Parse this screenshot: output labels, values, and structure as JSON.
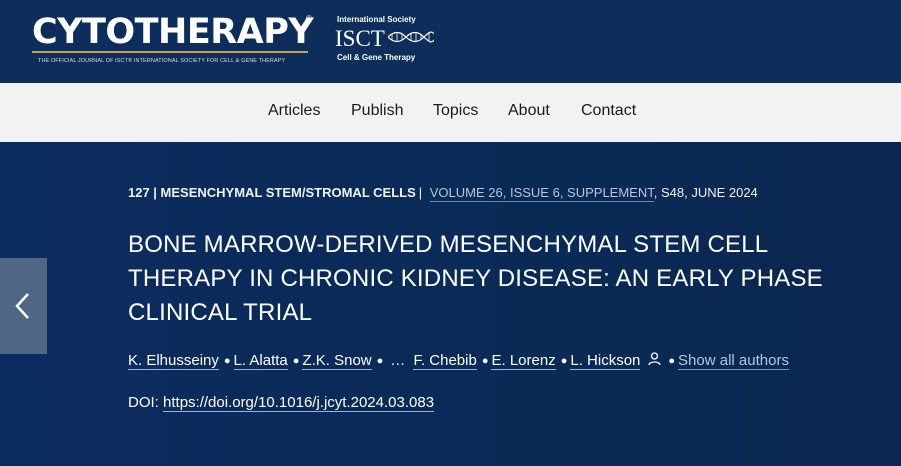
{
  "header": {
    "logo": "CYTOTHERAPY",
    "logo_reg": "®",
    "tagline": "THE OFFICIAL JOURNAL OF ISCT® INTERNATIONAL SOCIETY FOR CELL & GENE THERAPY",
    "isct_top": "International Society",
    "isct_name": "ISCT",
    "isct_sub": "Cell & Gene Therapy"
  },
  "nav": {
    "items": [
      {
        "label": "Articles"
      },
      {
        "label": "Publish"
      },
      {
        "label": "Topics"
      },
      {
        "label": "About"
      },
      {
        "label": "Contact"
      }
    ]
  },
  "article": {
    "section": "127 | MESENCHYMAL STEM/STROMAL CELLS",
    "separator": "|",
    "volume_link": "VOLUME 26, ISSUE 6, SUPPLEMENT",
    "pages_date": ", S48, JUNE 2024",
    "title_lines": [
      "BONE MARROW-DERIVED MESENCHYMAL STEM CELL",
      "THERAPY IN CHRONIC KIDNEY DISEASE: AN EARLY PHASE",
      "CLINICAL TRIAL"
    ],
    "authors": [
      "K. Elhusseiny",
      "L. Alatta",
      "Z.K. Snow",
      "F. Chebib",
      "E. Lorenz",
      "L. Hickson"
    ],
    "ellipsis": "…",
    "bullet": "●",
    "show_all": "Show all authors",
    "doi_label": "DOI:",
    "doi_link": "https://doi.org/10.1016/j.jcyt.2024.03.083"
  },
  "icons": {
    "prev": "chevron-left-icon",
    "person": "person-icon",
    "helix": "dna-helix-icon"
  },
  "colors": {
    "header_bg": "#0d2d5a",
    "nav_bg": "#f2f2f2",
    "hero_bg": "#0a2a56",
    "prev_button": "#4f6784",
    "accent_rule": "#c8a24a",
    "muted_link": "#b7c6da"
  }
}
